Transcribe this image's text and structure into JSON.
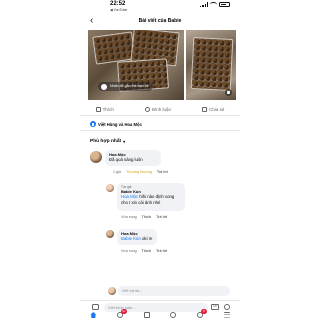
{
  "status_bar": {
    "time": "22:52",
    "back_app": "◀ YouTube"
  },
  "header": {
    "title": "Bài viết của Babie"
  },
  "photo": {
    "tag_label": "Nhấn để gắn thẻ bạn bè"
  },
  "actions": {
    "like": "Thích",
    "comment": "Bình luận",
    "share": "Chia sẻ"
  },
  "reactions": {
    "names": "Việt Hùng và Hoa Mộc"
  },
  "sort": {
    "label": "Phù hợp nhất"
  },
  "comments": [
    {
      "author": "Hoa Mộc",
      "text": "Đã quá sáng luôn",
      "time": "1 giờ",
      "like_label": "Thương thương",
      "reply_label": "Trả lời"
    }
  ],
  "replies": [
    {
      "tag_author": "Tác giả",
      "author": "Babie Kún",
      "mention": "Hoa Mộc",
      "text": " hihi nào định xong cho t xin cái ảnh nhé",
      "time": "Vừa xong",
      "like_label": "Thích",
      "reply_label": "Trả lời"
    },
    {
      "author": "Hoa Mộc",
      "mention": "Babie Kún",
      "text": " oki m",
      "time": "Vừa xong",
      "like_label": "Thích",
      "reply_label": "Trả lời"
    }
  ],
  "reply_input": {
    "placeholder": "Viết trả lời..."
  },
  "composer": {
    "placeholder": "Viết bình luận...",
    "gif_label": "GIF"
  },
  "tabbar": {
    "badges": [
      "",
      "9+",
      "",
      "",
      "6",
      ""
    ]
  },
  "colors": {
    "accent": "#1877f2",
    "liked": "#d4a017",
    "badge": "#e41e3f"
  }
}
